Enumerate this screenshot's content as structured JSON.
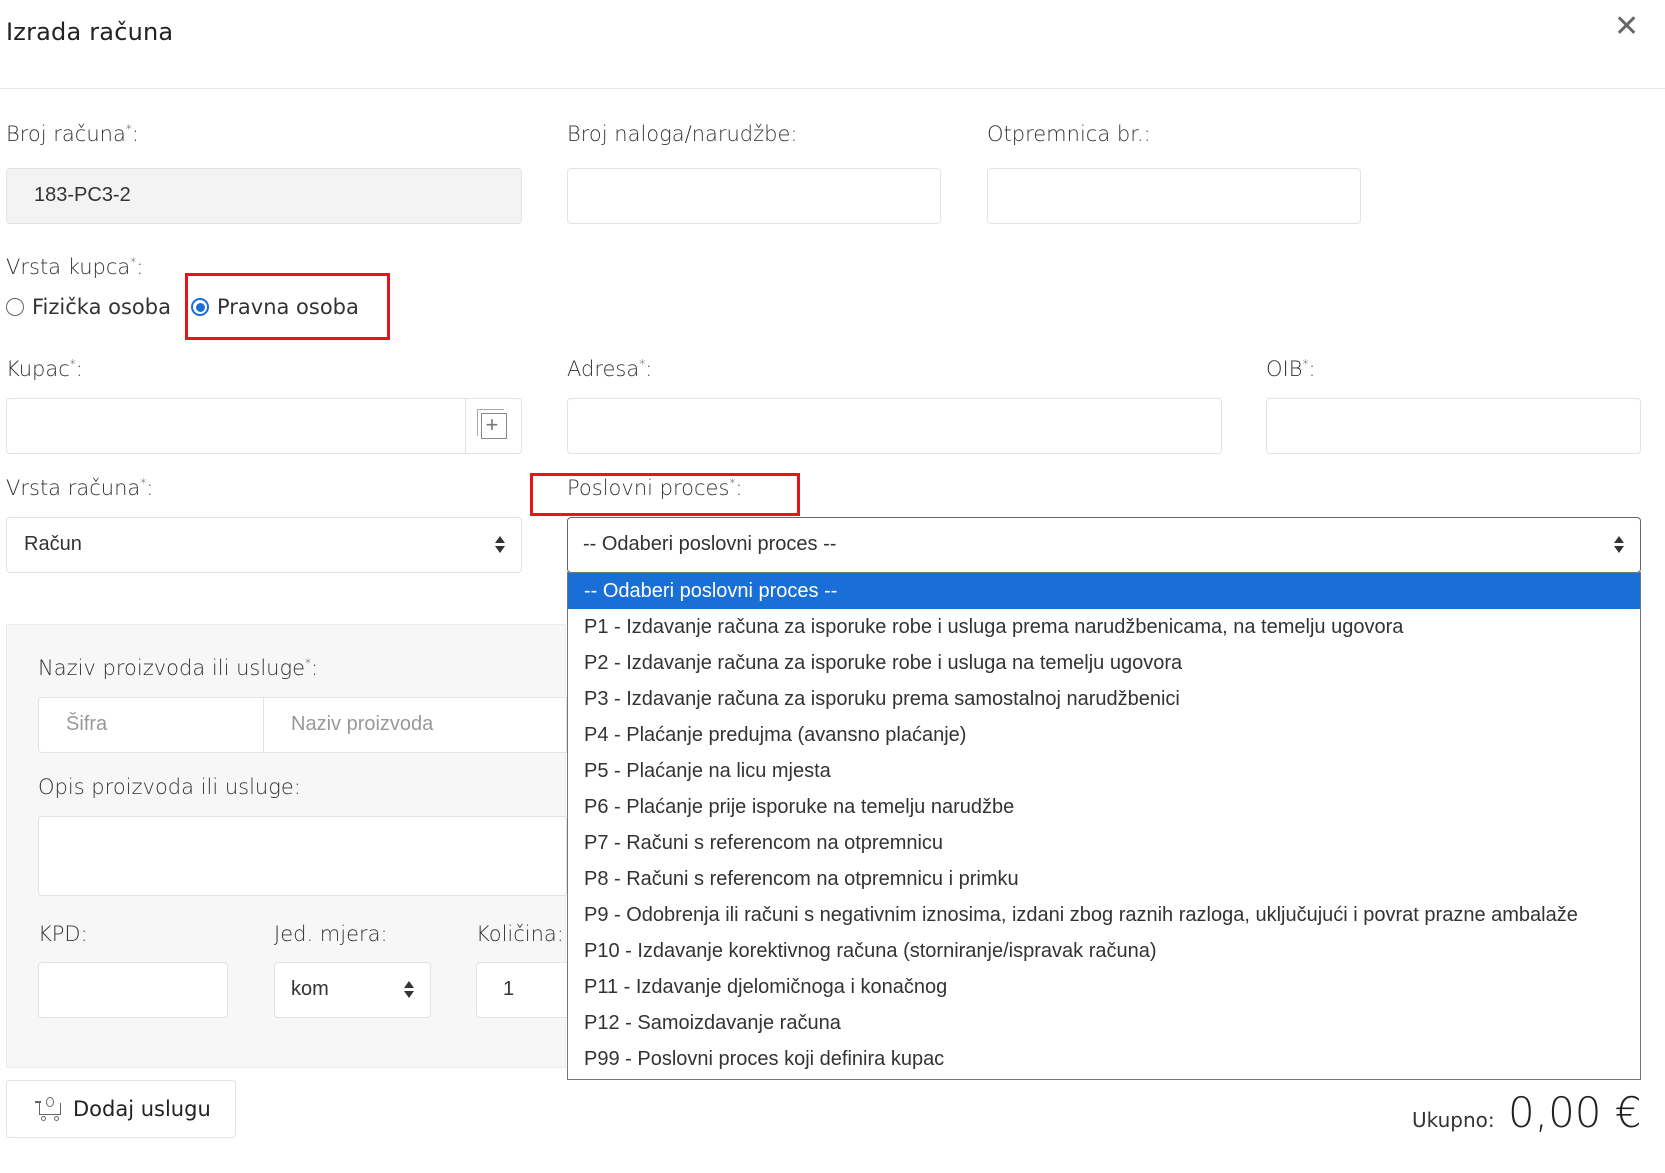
{
  "modal": {
    "title": "Izrada računa",
    "close_symbol": "✕"
  },
  "fields": {
    "invoice_number": {
      "label": "Broj računa",
      "required_mark": "*",
      "suffix": ":",
      "value": "183-PC3-2"
    },
    "order_number": {
      "label": "Broj naloga/narudžbe:",
      "value": ""
    },
    "delivery_note": {
      "label": "Otpremnica br.:",
      "value": ""
    },
    "customer_type": {
      "label": "Vrsta kupca",
      "required_mark": "*",
      "suffix": ":",
      "options": [
        "Fizička osoba",
        "Pravna osoba"
      ],
      "selected": "Pravna osoba"
    },
    "customer": {
      "label": "Kupac",
      "required_mark": "*",
      "suffix": ":",
      "value": ""
    },
    "address": {
      "label": "Adresa",
      "required_mark": "*",
      "suffix": ":",
      "value": ""
    },
    "oib": {
      "label": "OIB",
      "required_mark": "*",
      "suffix": ":",
      "value": ""
    },
    "invoice_type": {
      "label": "Vrsta računa",
      "required_mark": "*",
      "suffix": ":",
      "value": "Račun"
    },
    "business_process": {
      "label": "Poslovni proces",
      "required_mark": "*",
      "suffix": ":",
      "value": "-- Odaberi poslovni proces --",
      "options": [
        "-- Odaberi poslovni proces --",
        "P1 - Izdavanje računa za isporuke robe i usluga prema narudžbenicama, na temelju ugovora",
        "P2 - Izdavanje računa za isporuke robe i usluga na temelju ugovora",
        "P3 - Izdavanje računa za isporuku prema samostalnoj narudžbenici",
        "P4 - Plaćanje predujma (avansno plaćanje)",
        "P5 - Plaćanje na licu mjesta",
        "P6 - Plaćanje prije isporuke na temelju narudžbe",
        "P7 - Računi s referencom na otpremnicu",
        "P8 - Računi s referencom na otpremnicu i primku",
        "P9 - Odobrenja ili računi s negativnim iznosima, izdani zbog raznih razloga, uključujući i povrat prazne ambalaže",
        "P10 - Izdavanje korektivnog računa (storniranje/ispravak računa)",
        "P11 - Izdavanje djelomičnoga i konačnog",
        "P12 - Samoizdavanje računa",
        "P99 - Poslovni proces koji definira kupac"
      ],
      "highlighted_index": 0
    }
  },
  "product_panel": {
    "name_label": "Naziv proizvoda ili usluge",
    "required_mark": "*",
    "suffix": ":",
    "code_placeholder": "Šifra",
    "name_placeholder": "Naziv proizvoda",
    "description_label": "Opis proizvoda ili usluge:",
    "kpd_label": "KPD:",
    "unit_label": "Jed. mjera:",
    "unit_value": "kom",
    "quantity_label": "Količina:",
    "quantity_value": "1"
  },
  "actions": {
    "add_service_label": "Dodaj uslugu"
  },
  "totals": {
    "label": "Ukupno:",
    "value": "0,00 €"
  },
  "colors": {
    "accent": "#1a6fd6",
    "highlight_box": "#e8141c",
    "readonly_bg": "#f3f3f3"
  }
}
